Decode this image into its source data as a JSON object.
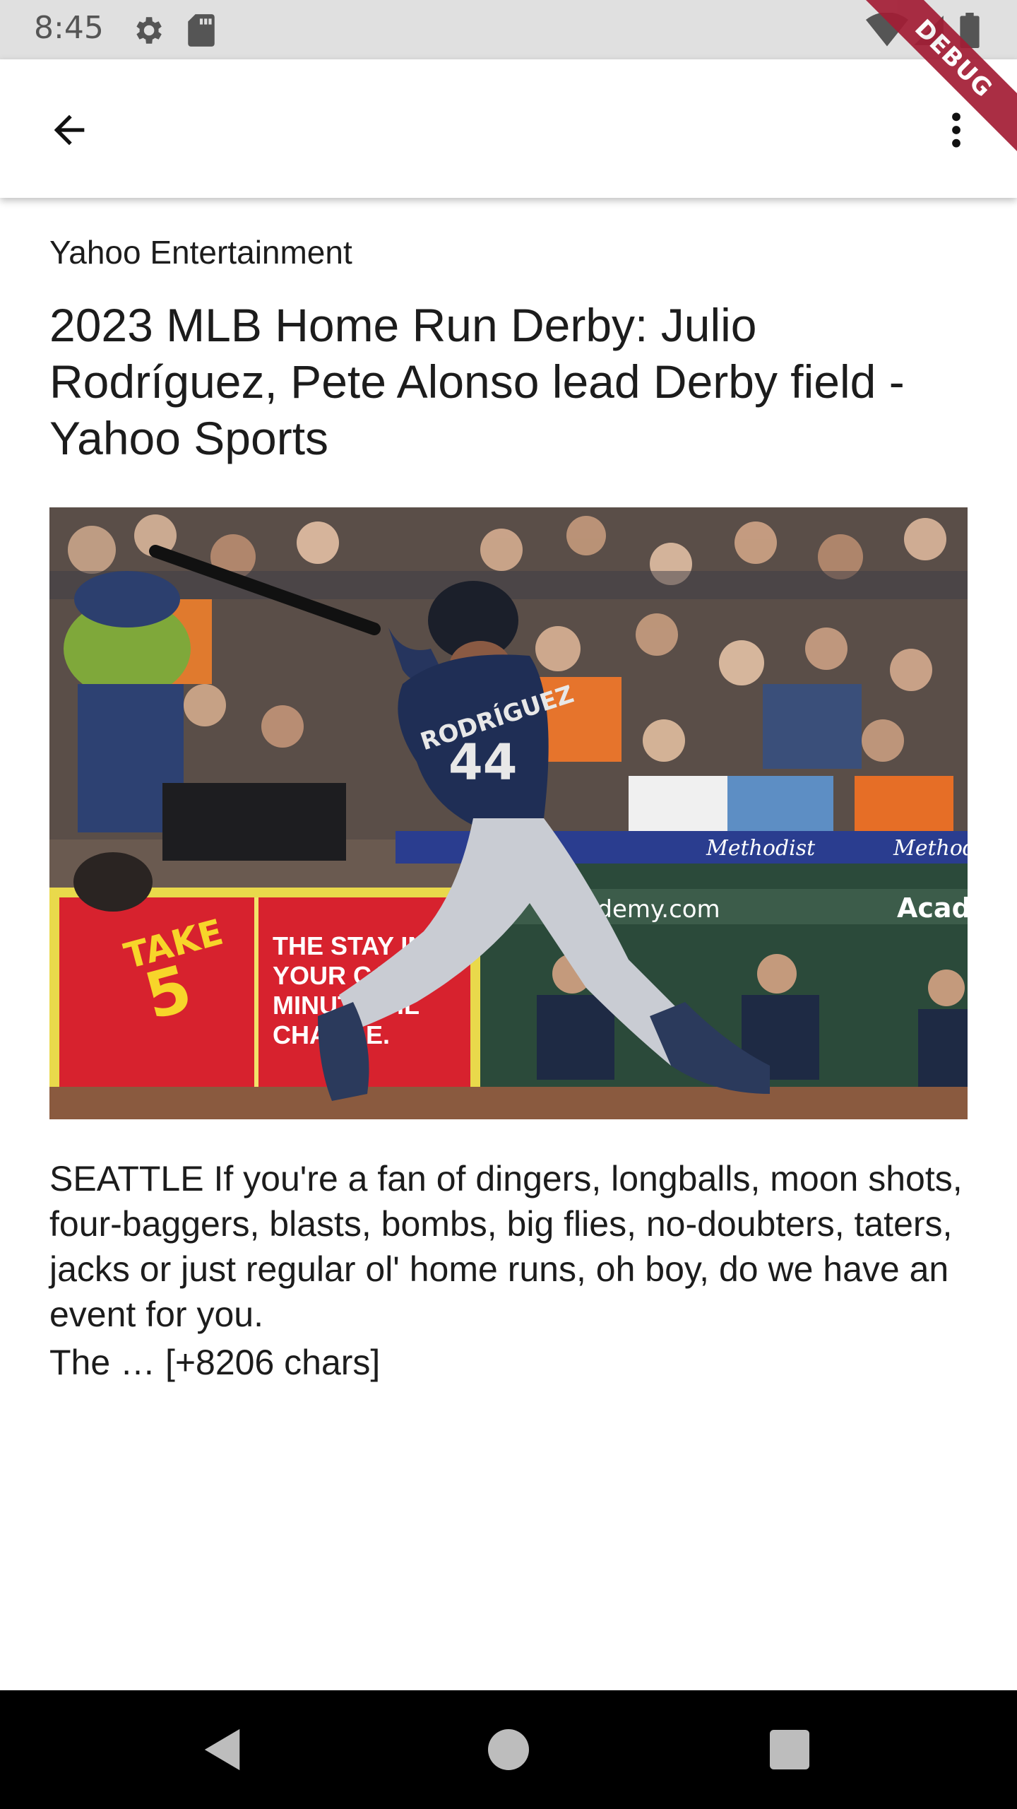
{
  "status_bar": {
    "time": "8:45",
    "icons": [
      "gear-icon",
      "sd-card-icon",
      "wifi-icon",
      "signal-icon",
      "battery-icon"
    ]
  },
  "debug_banner": "DEBUG",
  "app_bar": {
    "back_icon": "arrow-back-icon",
    "menu_icon": "more-vert-icon"
  },
  "article": {
    "source": "Yahoo Entertainment",
    "title": "2023 MLB Home Run Derby: Julio Rodríguez, Pete Alonso lead Derby field - Yahoo Sports",
    "image": {
      "player_name": "RODRÍGUEZ",
      "player_number": "44",
      "ad_left_line1": "TAKE",
      "ad_left_line2": "5",
      "ad_left_text": "THE STAY IN YOUR CAR 10 MINUTE OIL CHANGE.",
      "ad_banner": "academy.com",
      "ad_banner_right": "Acade",
      "rail_banner": "Methodist"
    },
    "description": "SEATTLE If you're a fan of dingers, longballs, moon shots, four-baggers, blasts, bombs, big flies, no-doubters, taters, jacks or just regular ol' home runs, oh boy, do we have an event for you.",
    "content_tail": "The … [+8206 chars]"
  },
  "nav_bar": {
    "back_icon": "nav-back-icon",
    "home_icon": "nav-home-icon",
    "recents_icon": "nav-recents-icon"
  },
  "colors": {
    "status_bar_bg": "#e0e0e0",
    "nav_bar_bg": "#000000",
    "debug_ribbon": "#a31d35"
  }
}
